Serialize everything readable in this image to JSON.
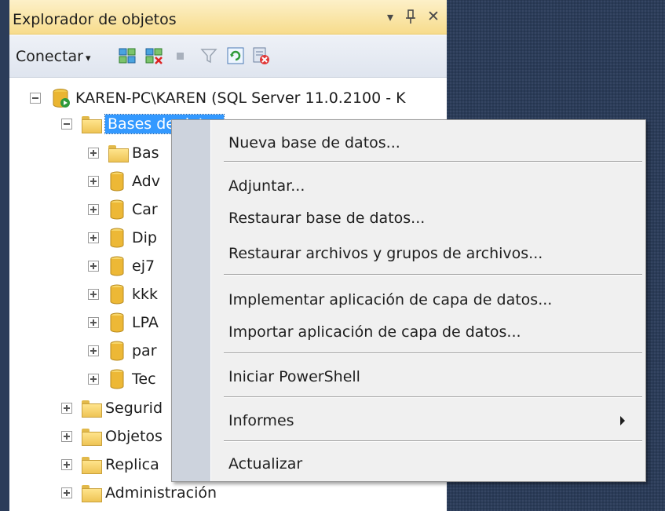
{
  "window": {
    "title": "Explorador de objetos",
    "dropdown_glyph": "▾",
    "pin_glyph": "ꟾ",
    "close_glyph": "✕"
  },
  "toolbar": {
    "connect_label": "Conectar",
    "connect_arrow": "▾",
    "icons": [
      "connect-object-explorer-icon",
      "disconnect-icon",
      "stop-icon",
      "filter-icon",
      "refresh-icon",
      "disconnect-all-icon"
    ]
  },
  "tree": {
    "server": "KAREN-PC\\KAREN (SQL Server 11.0.2100 - K",
    "databases_folder": "Bases de datos",
    "children": [
      "Bas",
      "Adv",
      "Car",
      "Dip",
      "ej7",
      "kkk",
      "LPA",
      "par",
      "Tec"
    ],
    "siblings": [
      "Segurid",
      "Objetos",
      "Replica",
      "Administración"
    ]
  },
  "context_menu": {
    "items": [
      "Nueva base de datos...",
      "Adjuntar...",
      "Restaurar base de datos...",
      "Restaurar archivos y grupos de archivos...",
      "Implementar aplicación de capa de datos...",
      "Importar aplicación de capa de datos...",
      "Iniciar PowerShell",
      "Informes",
      "Actualizar"
    ]
  },
  "colors": {
    "title_bar": "#f7dc8c",
    "selection": "#3399ff",
    "menu_bg": "#f0f0f0",
    "menu_gutter": "#cdd3dd",
    "desktop": "#2b3c59"
  }
}
